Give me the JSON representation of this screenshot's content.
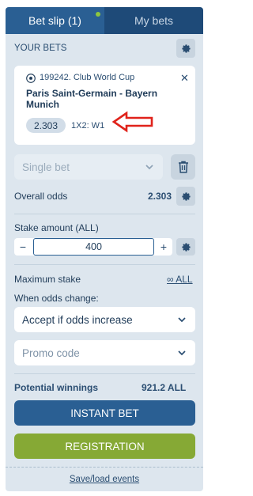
{
  "tabs": {
    "bet_slip": "Bet slip (1)",
    "my_bets": "My bets"
  },
  "your_bets_label": "YOUR BETS",
  "bet": {
    "league": "199242. Club World Cup",
    "match": "Paris Saint-Germain - Bayern Munich",
    "odds": "2.303",
    "outcome": "1X2: W1"
  },
  "bet_type": {
    "selected": "Single bet"
  },
  "overall_odds": {
    "label": "Overall odds",
    "value": "2.303"
  },
  "stake": {
    "label": "Stake amount (ALL)",
    "value": "400",
    "minus": "−",
    "plus": "+"
  },
  "maximum_stake": {
    "label": "Maximum stake",
    "value": "∞ ALL"
  },
  "odds_change": {
    "label": "When odds change:",
    "selected": "Accept if odds increase"
  },
  "promo": {
    "placeholder": "Promo code"
  },
  "potential_winnings": {
    "label": "Potential winnings",
    "value": "921.2 ALL"
  },
  "buttons": {
    "instant_bet": "INSTANT BET",
    "registration": "REGISTRATION"
  },
  "save_load": "Save/load events",
  "icons": {
    "settings": "gear-icon",
    "close": "close-icon",
    "delete": "trash-icon",
    "dropdown": "chevron-down-icon",
    "sport": "football-icon",
    "annotation": "red-arrow-icon"
  },
  "colors": {
    "tab_active": "#2a5f93",
    "tab_inactive": "#1e4a78",
    "panel_bg": "#dde6ee",
    "registration": "#86a935",
    "annotation_arrow": "#e0231b",
    "indicator_dot": "#8dc63f"
  }
}
